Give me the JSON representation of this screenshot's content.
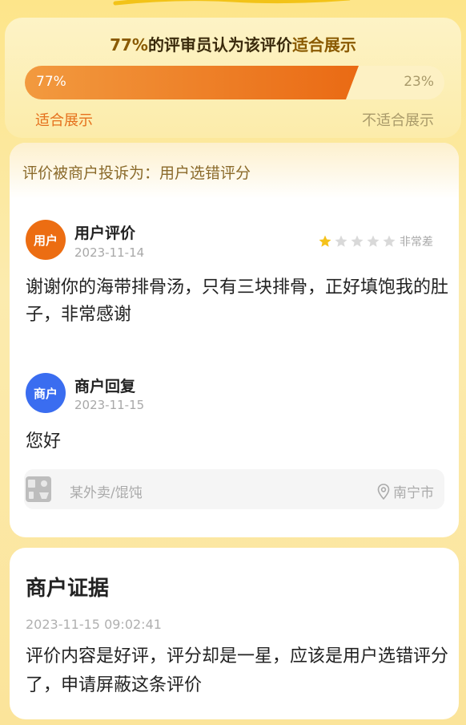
{
  "vote": {
    "percent_text": "77%",
    "title_mid": "的评审员认为该评价",
    "title_accent": "适合展示",
    "suitable_fraction": 0.77,
    "suitable_pct": "77%",
    "unsuitable_pct": "23%",
    "suitable_label": "适合展示",
    "unsuitable_label": "不适合展示"
  },
  "complaint": {
    "label": "评价被商户投诉为：用户选错评分"
  },
  "user_review": {
    "avatar_text": "用户",
    "name": "用户评价",
    "date": "2023-11-14",
    "stars_filled": 1,
    "stars_total": 5,
    "rating_text": "非常差",
    "text": "谢谢你的海带排骨汤，只有三块排骨，正好填饱我的肚子，非常感谢"
  },
  "merchant_reply": {
    "avatar_text": "商户",
    "name": "商户回复",
    "date": "2023-11-15",
    "text": "您好"
  },
  "store": {
    "name": "某外卖/馄饨",
    "location": "南宁市"
  },
  "evidence": {
    "title": "商户证据",
    "time": "2023-11-15 09:02:41",
    "text": "评价内容是好评，评分却是一星，应该是用户选错评分了，申请屏蔽这条评价"
  },
  "colors": {
    "accent_orange": "#ec6d12",
    "merchant_blue": "#3a6df0",
    "star_gold": "#f5c21b",
    "star_gray": "#d9d9d9"
  }
}
